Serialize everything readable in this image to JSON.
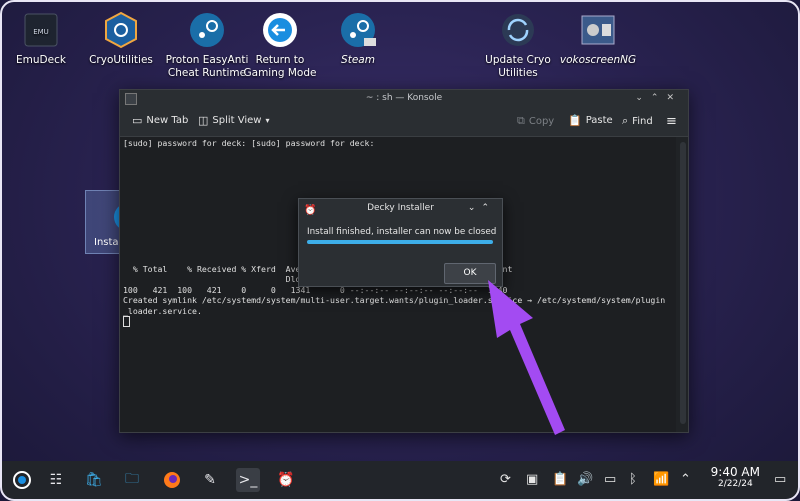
{
  "desktop": {
    "icons": [
      {
        "label": "EmuDeck",
        "name": "emudeck-icon"
      },
      {
        "label": "CryoUtilities",
        "name": "cryoutilities-icon"
      },
      {
        "label": "Proton EasyAnti\nCheat Runtime",
        "line1": "Proton EasyAnti",
        "line2": "Cheat Runtime"
      },
      {
        "line1": "Return to",
        "line2": "Gaming Mode"
      },
      {
        "label": "Steam"
      },
      {
        "line1": "Update Cryo",
        "line2": "Utilities"
      },
      {
        "label": "vokoscreenNG"
      }
    ],
    "selected_icon_label": "Install Decky"
  },
  "konsole": {
    "title": "~ : sh — Konsole",
    "toolbar": {
      "new_tab": "New Tab",
      "split_view": "Split View",
      "copy": "Copy",
      "paste": "Paste",
      "find": "Find"
    },
    "lines": {
      "l1": "[sudo] password for deck: [sudo] password for deck:",
      "l2": "  % Total    % Received % Xferd  Average Speed   Time    Time     Time  Current",
      "l3": "                                 Dload  Upload   Total   Spent    Left  Speed",
      "l4": "100   421  100   421    0     0   1341      0 --:--:-- --:--:-- --:--:--  1340",
      "l5": "Created symlink /etc/systemd/system/multi-user.target.wants/plugin_loader.service → /etc/systemd/system/plugin",
      "l6": "_loader.service."
    }
  },
  "dialog": {
    "title": "Decky Installer",
    "message": "Install finished, installer can now be closed",
    "progress_percent": 100,
    "ok_label": "OK"
  },
  "taskbar": {
    "time": "9:40 AM",
    "date": "2/22/24"
  },
  "colors": {
    "accent": "#3daee9",
    "arrow": "#a34bf2"
  }
}
